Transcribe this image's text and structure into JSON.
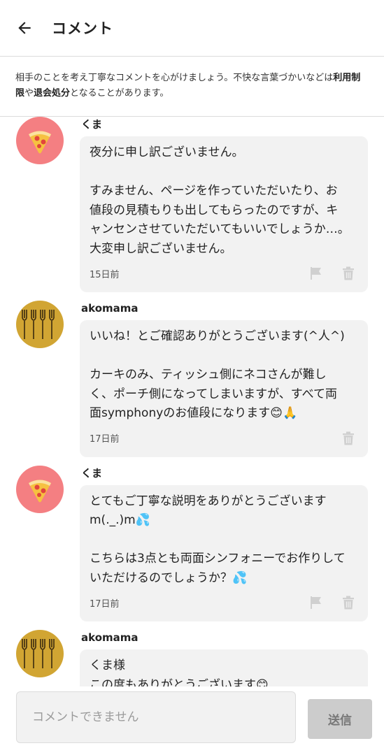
{
  "header": {
    "title": "コメント",
    "back_icon": "arrow-left-icon"
  },
  "notice": {
    "text_before": "相手のことを考え丁寧なコメントを心がけましょう。不快な言葉づかいなどは",
    "bold_1": "利用制限",
    "text_middle": "や",
    "bold_2": "退会処分",
    "text_after": "となることがあります。"
  },
  "comments": [
    {
      "user": "くま",
      "avatar": "pizza-icon",
      "lines": [
        "夜分に申し訳ございません。",
        "",
        "すみません、ページを作っていただいたり、お",
        "値段の見積もりも出してもらったのですが、キ",
        "ャンセンさせていただいてもいいでしょうか…。",
        "大変申し訳ございません。"
      ],
      "time": "15日前",
      "flag": true
    },
    {
      "user": "akomama",
      "avatar": "forks-icon",
      "lines": [
        "いいね！とご確認ありがとうございます(^人^)",
        "",
        "カーキのみ、ティッシュ側にネコさんが難し",
        "く、ポーチ側になってしまいますが、すべて両",
        "面symphonyのお値段になります😊🙏"
      ],
      "time": "17日前",
      "flag": false
    },
    {
      "user": "くま",
      "avatar": "pizza-icon",
      "lines": [
        "とてもご丁寧な説明をありがとうございます",
        "m(._.)m💦",
        "",
        "こちらは3点とも両面シンフォニーでお作りして",
        "いただけるのでしょうか？💦"
      ],
      "time": "17日前",
      "flag": true
    },
    {
      "user": "akomama",
      "avatar": "forks-icon",
      "lines": [
        "くま様",
        "この度もありがとうございます😊"
      ],
      "time": "",
      "flag": false
    }
  ],
  "footer": {
    "placeholder": "コメントできません",
    "send_label": "送信"
  },
  "colors": {
    "pizza_avatar": "#f47f82",
    "fork_avatar": "#d1a533",
    "bubble": "#f2f2f2",
    "send_disabled": "#cccccc"
  }
}
